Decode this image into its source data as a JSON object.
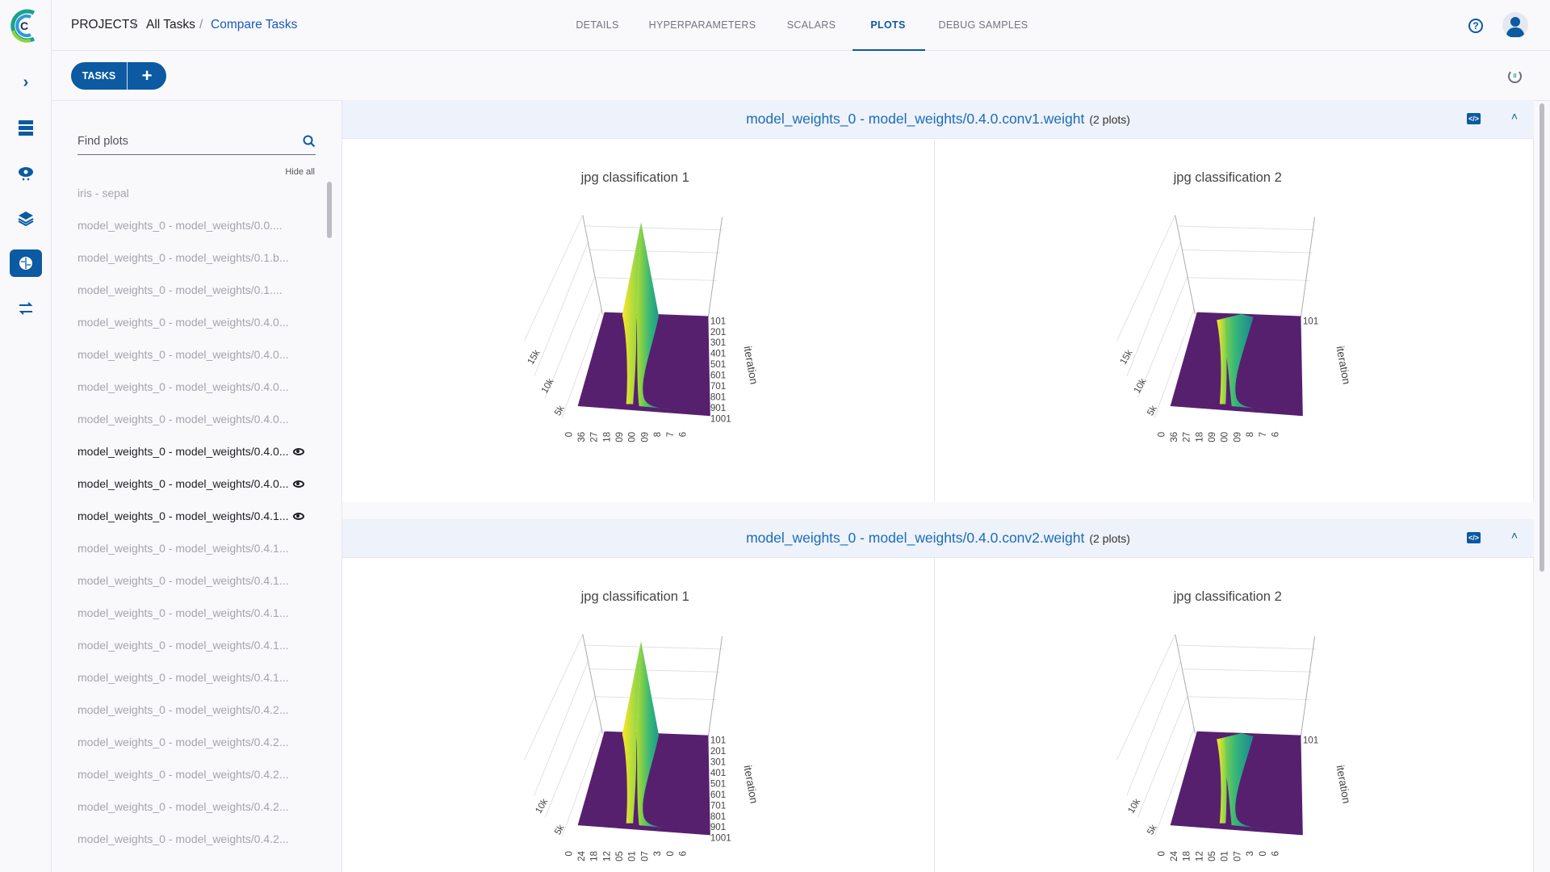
{
  "breadcrumb": {
    "projects": "PROJECTS",
    "all_tasks": "All Tasks",
    "current": "Compare Tasks"
  },
  "tabs": [
    {
      "label": "DETAILS"
    },
    {
      "label": "HYPERPARAMETERS"
    },
    {
      "label": "SCALARS"
    },
    {
      "label": "PLOTS",
      "active": true
    },
    {
      "label": "DEBUG SAMPLES"
    }
  ],
  "toolbar": {
    "tasks_label": "TASKS",
    "add_label": "+"
  },
  "icons": {
    "help": "help-circle-icon",
    "user": "user-avatar-icon",
    "refresh": "auto-refresh-pause-icon",
    "embed": "code-embed-icon",
    "collapse": "chevron-up-icon",
    "search": "search-icon",
    "visible": "eye-icon"
  },
  "colors": {
    "accent": "#0b5aa2",
    "title_link": "#1a6dba",
    "surface_low": "#57206f",
    "surface_high": "#fde725"
  },
  "left_panel": {
    "search_placeholder": "Find plots",
    "hide_all": "Hide all",
    "items": [
      {
        "label": "iris - sepal",
        "visible": false
      },
      {
        "label": "model_weights_0 - model_weights/0.0....",
        "visible": false
      },
      {
        "label": "model_weights_0 - model_weights/0.1.b...",
        "visible": false
      },
      {
        "label": "model_weights_0 - model_weights/0.1....",
        "visible": false
      },
      {
        "label": "model_weights_0 - model_weights/0.4.0...",
        "visible": false
      },
      {
        "label": "model_weights_0 - model_weights/0.4.0...",
        "visible": false
      },
      {
        "label": "model_weights_0 - model_weights/0.4.0...",
        "visible": false
      },
      {
        "label": "model_weights_0 - model_weights/0.4.0...",
        "visible": false
      },
      {
        "label": "model_weights_0 - model_weights/0.4.0...",
        "visible": true
      },
      {
        "label": "model_weights_0 - model_weights/0.4.0...",
        "visible": true
      },
      {
        "label": "model_weights_0 - model_weights/0.4.1...",
        "visible": true
      },
      {
        "label": "model_weights_0 - model_weights/0.4.1...",
        "visible": false
      },
      {
        "label": "model_weights_0 - model_weights/0.4.1...",
        "visible": false
      },
      {
        "label": "model_weights_0 - model_weights/0.4.1...",
        "visible": false
      },
      {
        "label": "model_weights_0 - model_weights/0.4.1...",
        "visible": false
      },
      {
        "label": "model_weights_0 - model_weights/0.4.1...",
        "visible": false
      },
      {
        "label": "model_weights_0 - model_weights/0.4.2...",
        "visible": false
      },
      {
        "label": "model_weights_0 - model_weights/0.4.2...",
        "visible": false
      },
      {
        "label": "model_weights_0 - model_weights/0.4.2...",
        "visible": false
      },
      {
        "label": "model_weights_0 - model_weights/0.4.2...",
        "visible": false
      },
      {
        "label": "model_weights_0 - model_weights/0.4.2...",
        "visible": false
      }
    ]
  },
  "sections": [
    {
      "title": "model_weights_0 - model_weights/0.4.0.conv1.weight",
      "count": "(2 plots)",
      "plots": [
        {
          "title": "jpg classification 1",
          "y_axis_label": "iteration",
          "y_ticks": [
            "101",
            "201",
            "301",
            "401",
            "501",
            "601",
            "701",
            "801",
            "901",
            "1001"
          ],
          "z_ticks": [
            "15k",
            "10k",
            "5k"
          ],
          "x_ticks": [
            "0",
            "36",
            "27",
            "18",
            "09",
            "00",
            "09",
            "8",
            "7",
            "6"
          ]
        },
        {
          "title": "jpg classification 2",
          "y_axis_label": "iteration",
          "y_ticks": [
            "101"
          ],
          "z_ticks": [
            "15k",
            "10k",
            "5k"
          ],
          "x_ticks": [
            "0",
            "36",
            "27",
            "18",
            "09",
            "00",
            "09",
            "8",
            "7",
            "6"
          ]
        }
      ]
    },
    {
      "title": "model_weights_0 - model_weights/0.4.0.conv2.weight",
      "count": "(2 plots)",
      "plots": [
        {
          "title": "jpg classification 1",
          "y_axis_label": "iteration",
          "y_ticks": [
            "101",
            "201",
            "301",
            "401",
            "501",
            "601",
            "701",
            "801",
            "901",
            "1001"
          ],
          "z_ticks": [
            "10k",
            "5k"
          ],
          "x_ticks": [
            "0",
            "24",
            "18",
            "12",
            "05",
            "01",
            "07",
            "3",
            "0",
            "6"
          ]
        },
        {
          "title": "jpg classification 2",
          "y_axis_label": "iteration",
          "y_ticks": [
            "101"
          ],
          "z_ticks": [
            "10k",
            "5k"
          ],
          "x_ticks": [
            "0",
            "24",
            "18",
            "12",
            "05",
            "01",
            "07",
            "3",
            "0",
            "6"
          ]
        }
      ]
    }
  ]
}
